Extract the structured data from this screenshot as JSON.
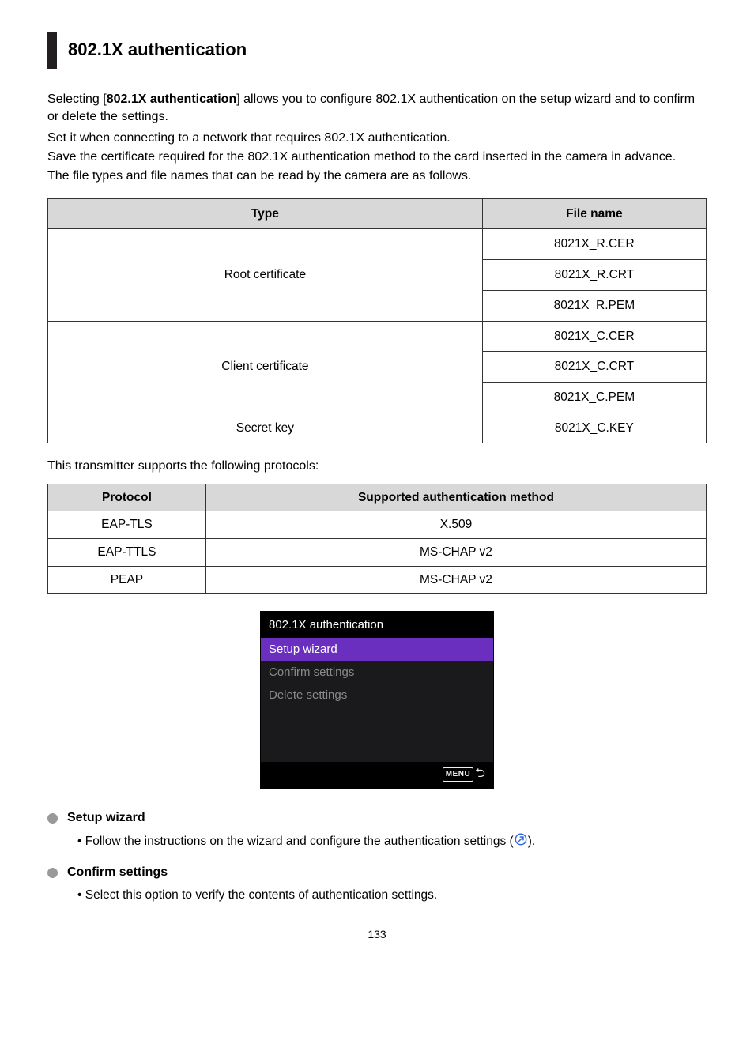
{
  "sectionTitle": "802.1X authentication",
  "intro": {
    "prefix": "Selecting [",
    "boldKey": "802.1X authentication",
    "afterBold": "] allows you to configure 802.1X authentication on the setup wizard and to confirm or delete the settings.",
    "line2": "Set it when connecting to a network that requires 802.1X authentication.",
    "line3": "Save the certificate required for the 802.1X authentication method to the card inserted in the camera in advance.",
    "line4": "The file types and file names that can be read by the camera are as follows."
  },
  "certTable": {
    "headers": {
      "type": "Type",
      "file": "File name"
    },
    "groups": [
      {
        "type": "Root certificate",
        "files": [
          "8021X_R.CER",
          "8021X_R.CRT",
          "8021X_R.PEM"
        ]
      },
      {
        "type": "Client certificate",
        "files": [
          "8021X_C.CER",
          "8021X_C.CRT",
          "8021X_C.PEM"
        ]
      },
      {
        "type": "Secret key",
        "files": [
          "8021X_C.KEY"
        ]
      }
    ]
  },
  "transmitterLine": "This transmitter supports the following protocols:",
  "protoTable": {
    "headers": {
      "protocol": "Protocol",
      "method": "Supported authentication method"
    },
    "rows": [
      {
        "protocol": "EAP-TLS",
        "method": "X.509"
      },
      {
        "protocol": "EAP-TTLS",
        "method": "MS-CHAP v2"
      },
      {
        "protocol": "PEAP",
        "method": "MS-CHAP v2"
      }
    ]
  },
  "screenshot": {
    "title": "802.1X authentication",
    "item1": "Setup wizard",
    "item2": "Confirm settings",
    "item3": "Delete settings",
    "menuLabel": "MENU"
  },
  "setupWizard": {
    "heading": "Setup wizard",
    "bullet_pre": "Follow the instructions on the wizard and configure the authentication settings (",
    "bullet_post": ")."
  },
  "confirmSettings": {
    "heading": "Confirm settings",
    "bullet": "Select this option to verify the contents of authentication settings."
  },
  "pageNumber": "133"
}
